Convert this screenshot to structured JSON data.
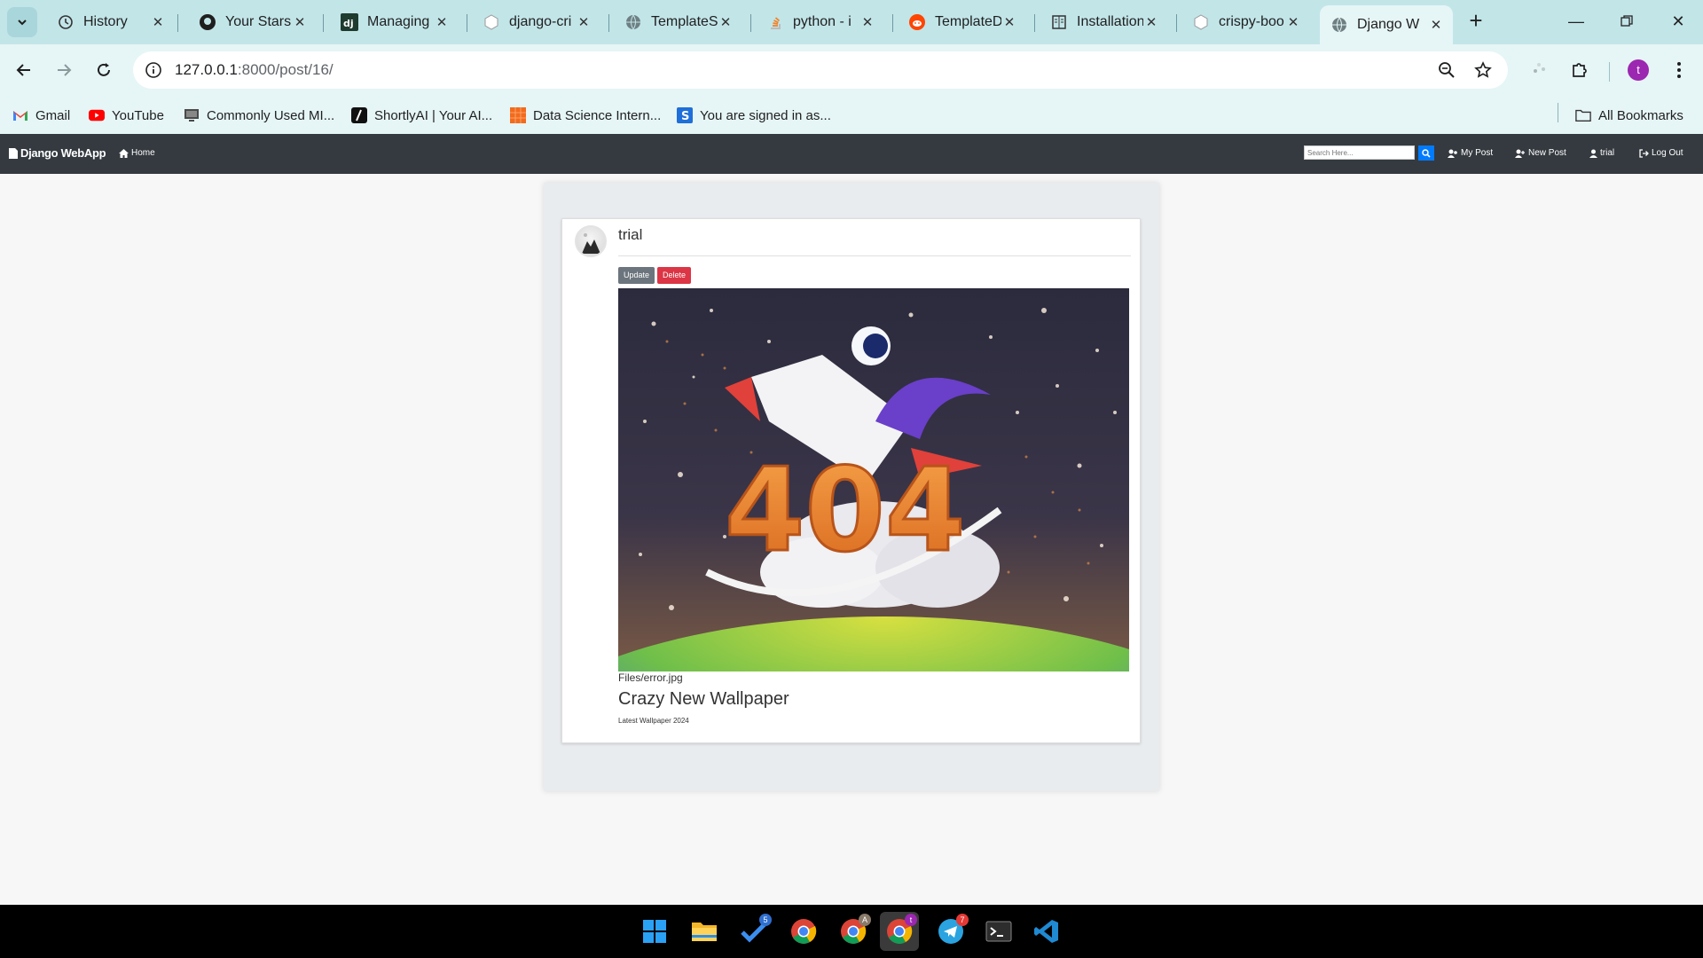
{
  "browser": {
    "tabs": [
      {
        "label": "History",
        "icon": "history-icon"
      },
      {
        "label": "Your Stars",
        "icon": "github-icon"
      },
      {
        "label": "Managing",
        "icon": "django-icon"
      },
      {
        "label": "django-cri",
        "icon": "cube-icon"
      },
      {
        "label": "TemplateS",
        "icon": "globe-icon"
      },
      {
        "label": "python - i",
        "icon": "stackoverflow-icon"
      },
      {
        "label": "TemplateD",
        "icon": "reddit-icon"
      },
      {
        "label": "Installation",
        "icon": "docs-icon"
      },
      {
        "label": "crispy-boo",
        "icon": "cube-icon"
      },
      {
        "label": "Django W",
        "icon": "globe-icon",
        "active": true
      }
    ],
    "url_host": "127.0.0.1",
    "url_path": ":8000/post/16/",
    "profile_initial": "t",
    "bookmarks": [
      {
        "label": "Gmail",
        "icon": "gmail-icon"
      },
      {
        "label": "YouTube",
        "icon": "youtube-icon"
      },
      {
        "label": "Commonly Used MI...",
        "icon": "monitor-icon"
      },
      {
        "label": "ShortlyAI | Your AI...",
        "icon": "shortlyai-icon"
      },
      {
        "label": "Data Science Intern...",
        "icon": "orange-grid-icon"
      },
      {
        "label": "You are signed in as...",
        "icon": "s-icon"
      }
    ],
    "all_bookmarks_label": "All Bookmarks"
  },
  "site": {
    "brand": "Django WebApp",
    "home_label": "Home",
    "search_placeholder": "Search Here...",
    "my_post_label": "My Post",
    "new_post_label": "New Post",
    "user_label": "trial",
    "logout_label": "Log Out"
  },
  "post": {
    "author": "trial",
    "update_label": "Update",
    "delete_label": "Delete",
    "file_path": "Files/error.jpg",
    "title": "Crazy New Wallpaper",
    "content": "Latest Wallpaper 2024",
    "image_text": "404"
  },
  "taskbar": {
    "apps": [
      {
        "name": "windows-start-icon"
      },
      {
        "name": "file-explorer-icon"
      },
      {
        "name": "todo-icon",
        "badge": "5"
      },
      {
        "name": "chrome-icon"
      },
      {
        "name": "chrome-profile-a-icon",
        "badge": "A"
      },
      {
        "name": "chrome-profile-t-icon",
        "badge": "t",
        "active": true
      },
      {
        "name": "telegram-icon",
        "badge": "7"
      },
      {
        "name": "terminal-icon"
      },
      {
        "name": "vscode-icon"
      }
    ]
  },
  "colors": {
    "tabstrip": "#c2e5e8",
    "toolbar": "#e6f5f6",
    "navbar": "#343a40",
    "update": "#6c757d",
    "delete": "#dc3545",
    "search_button": "#007bff"
  }
}
